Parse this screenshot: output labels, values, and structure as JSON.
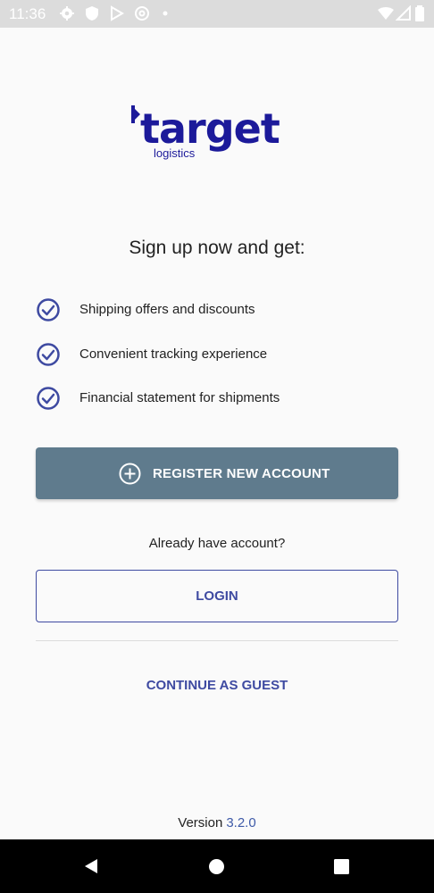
{
  "status_bar": {
    "time": "11:36"
  },
  "logo": {
    "wordmark": "target",
    "subtitle": "logistics"
  },
  "headline": "Sign up now and get:",
  "benefits": [
    {
      "label": "Shipping offers and discounts"
    },
    {
      "label": "Convenient tracking experience"
    },
    {
      "label": "Financial statement for shipments"
    }
  ],
  "register_button": {
    "label": "REGISTER NEW ACCOUNT"
  },
  "already_text": "Already have account?",
  "login_button": {
    "label": "LOGIN"
  },
  "guest_button": {
    "label": "CONTINUE AS GUEST"
  },
  "version": {
    "label": "Version",
    "number": "3.2.0"
  },
  "colors": {
    "brand": "#1c1a9a",
    "accent": "#3e4aa1",
    "register_bg": "#5f7b8d",
    "status_bar_bg": "#dcdcdc"
  }
}
